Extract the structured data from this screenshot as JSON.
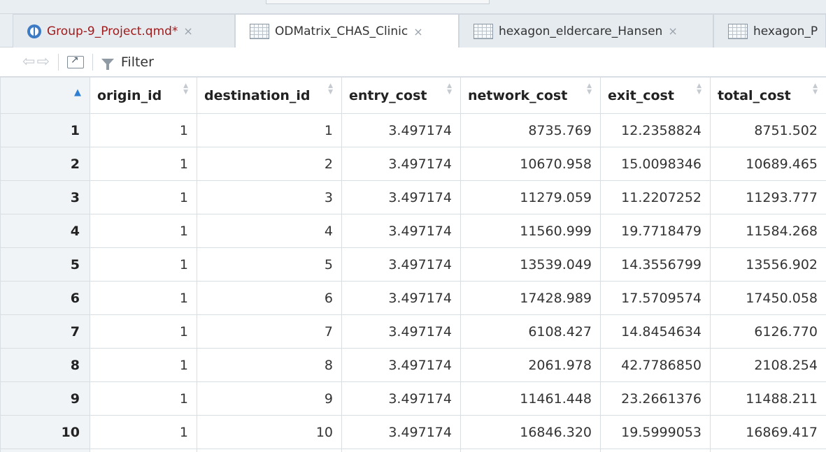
{
  "tabs": [
    {
      "label": "Group-9_Project.qmd*",
      "icon": "quarto-doc-icon",
      "modified": true,
      "active": false,
      "close": "×"
    },
    {
      "label": "ODMatrix_CHAS_Clinic",
      "icon": "table-icon",
      "modified": false,
      "active": true,
      "close": "×"
    },
    {
      "label": "hexagon_eldercare_Hansen",
      "icon": "table-icon",
      "modified": false,
      "active": false,
      "close": "×"
    },
    {
      "label": "hexagon_P",
      "icon": "table-icon",
      "modified": false,
      "active": false,
      "close": ""
    }
  ],
  "toolbar": {
    "back_icon": "⇦",
    "forward_icon": "⇨",
    "filter_label": "Filter"
  },
  "table": {
    "columns": [
      "origin_id",
      "destination_id",
      "entry_cost",
      "network_cost",
      "exit_cost",
      "total_cost"
    ],
    "rows": [
      [
        "1",
        "1",
        "1",
        "3.497174",
        "8735.769",
        "12.2358824",
        "8751.502"
      ],
      [
        "2",
        "1",
        "2",
        "3.497174",
        "10670.958",
        "15.0098346",
        "10689.465"
      ],
      [
        "3",
        "1",
        "3",
        "3.497174",
        "11279.059",
        "11.2207252",
        "11293.777"
      ],
      [
        "4",
        "1",
        "4",
        "3.497174",
        "11560.999",
        "19.7718479",
        "11584.268"
      ],
      [
        "5",
        "1",
        "5",
        "3.497174",
        "13539.049",
        "14.3556799",
        "13556.902"
      ],
      [
        "6",
        "1",
        "6",
        "3.497174",
        "17428.989",
        "17.5709574",
        "17450.058"
      ],
      [
        "7",
        "1",
        "7",
        "3.497174",
        "6108.427",
        "14.8454634",
        "6126.770"
      ],
      [
        "8",
        "1",
        "8",
        "3.497174",
        "2061.978",
        "42.7786850",
        "2108.254"
      ],
      [
        "9",
        "1",
        "9",
        "3.497174",
        "11461.448",
        "23.2661376",
        "11488.211"
      ],
      [
        "10",
        "1",
        "10",
        "3.497174",
        "16846.320",
        "19.5999053",
        "16869.417"
      ]
    ]
  }
}
